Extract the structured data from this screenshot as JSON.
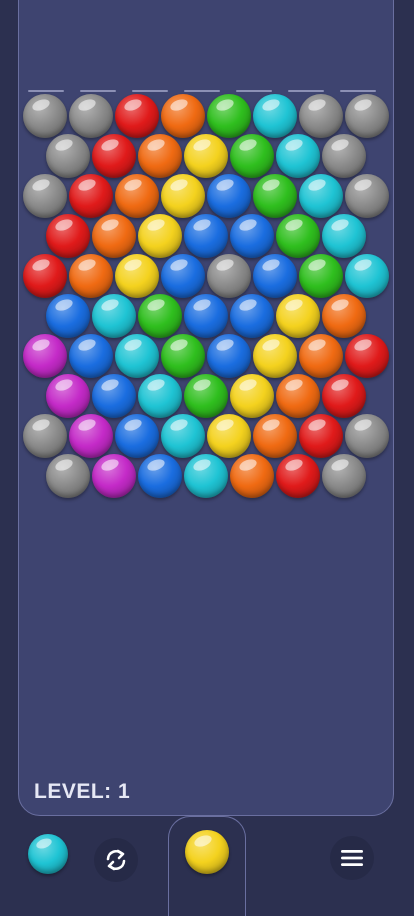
{
  "colors": {
    "background": "#2c3050",
    "playfield": "#3e4470",
    "border": "#6a6fa0",
    "bubble": {
      "gray": "#8a8a8a",
      "red": "#e01a1a",
      "orange": "#f06a12",
      "green": "#2fbf1e",
      "cyan": "#1fc4d4",
      "yellow": "#f4d21e",
      "blue": "#1a6de0",
      "magenta": "#c42ac8"
    }
  },
  "grid": {
    "rows": [
      [
        "gray",
        "gray",
        "red",
        "orange",
        "green",
        "cyan",
        "gray",
        "gray"
      ],
      [
        "gray",
        "red",
        "orange",
        "yellow",
        "green",
        "cyan",
        "gray"
      ],
      [
        "gray",
        "red",
        "orange",
        "yellow",
        "blue",
        "green",
        "cyan",
        "gray"
      ],
      [
        "red",
        "orange",
        "yellow",
        "blue",
        "blue",
        "green",
        "cyan"
      ],
      [
        "red",
        "orange",
        "yellow",
        "blue",
        "gray",
        "blue",
        "green",
        "cyan"
      ],
      [
        "blue",
        "cyan",
        "green",
        "blue",
        "blue",
        "yellow",
        "orange"
      ],
      [
        "magenta",
        "blue",
        "cyan",
        "green",
        "blue",
        "yellow",
        "orange",
        "red"
      ],
      [
        "magenta",
        "blue",
        "cyan",
        "green",
        "yellow",
        "orange",
        "red"
      ],
      [
        "gray",
        "magenta",
        "blue",
        "cyan",
        "yellow",
        "orange",
        "red",
        "gray"
      ],
      [
        "gray",
        "magenta",
        "blue",
        "cyan",
        "orange",
        "red",
        "gray"
      ]
    ]
  },
  "level": {
    "label": "LEVEL: 1"
  },
  "launcher": {
    "current": "yellow",
    "next": "cyan"
  },
  "icons": {
    "swap": "swap-icon",
    "menu": "menu-icon"
  }
}
